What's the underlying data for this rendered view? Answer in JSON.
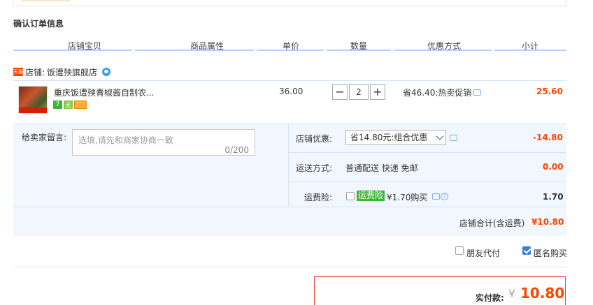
{
  "section_title": "确认订单信息",
  "columns": [
    "店铺宝贝",
    "商品属性",
    "单价",
    "数量",
    "优惠方式",
    "小计"
  ],
  "shop": {
    "icon_text": "天猫",
    "label": "店铺:",
    "name": "饭遭殃旗舰店"
  },
  "item": {
    "title": "重庆饭遭殃青椒酱自制农...",
    "badges": [
      "7",
      "无",
      ""
    ],
    "price": "36.00",
    "quantity": "2",
    "minus": "−",
    "plus": "+",
    "promo": "省46.40:热卖促销",
    "subtotal": "25.60"
  },
  "memo": {
    "label": "给卖家留言:",
    "placeholder": "选填,请先和商家协商一致",
    "counter": "0/200"
  },
  "shop_discount": {
    "label": "店铺优惠:",
    "selected": "省14.80元:组合优惠",
    "amount": "-14.80"
  },
  "shipping": {
    "label": "运送方式:",
    "value": "普通配送 快递 免邮",
    "amount": "0.00"
  },
  "insurance": {
    "label": "运费险:",
    "tag": "运费险",
    "price_text": "¥1.70购买",
    "q_mark": "?",
    "amount": "1.70"
  },
  "shop_total": {
    "label": "店铺合计(含运费)",
    "amount": "¥10.80"
  },
  "options": {
    "friend_pay": "朋友代付",
    "anonymous": "匿名购买"
  },
  "payment": {
    "label": "实付款:",
    "yen": "¥",
    "amount": "10.80"
  }
}
